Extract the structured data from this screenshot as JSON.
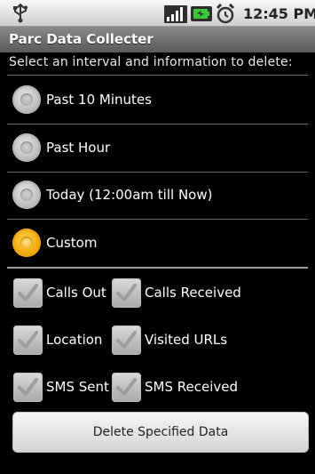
{
  "status_bar": {
    "time": "12:45 PM",
    "icons": [
      "usb-icon",
      "signal-icon",
      "battery-icon",
      "alarm-icon"
    ]
  },
  "app": {
    "title": "Parc Data Collecter",
    "instruction": "Select an interval and information to delete:"
  },
  "intervals": [
    {
      "label": "Past 10 Minutes",
      "selected": false
    },
    {
      "label": "Past Hour",
      "selected": false
    },
    {
      "label": "Today (12:00am till Now)",
      "selected": false
    },
    {
      "label": "Custom",
      "selected": true
    }
  ],
  "data_types": [
    {
      "label": "Calls Out",
      "checked": true
    },
    {
      "label": "Calls Received",
      "checked": true
    },
    {
      "label": "Location",
      "checked": true
    },
    {
      "label": "Visited URLs",
      "checked": true
    },
    {
      "label": "SMS Sent",
      "checked": true
    },
    {
      "label": "SMS Received",
      "checked": true
    }
  ],
  "actions": {
    "delete_label": "Delete Specified Data"
  },
  "colors": {
    "radio_selected": "#f7ad12",
    "radio_unselected": "#c8c8c8",
    "background": "#000000"
  }
}
